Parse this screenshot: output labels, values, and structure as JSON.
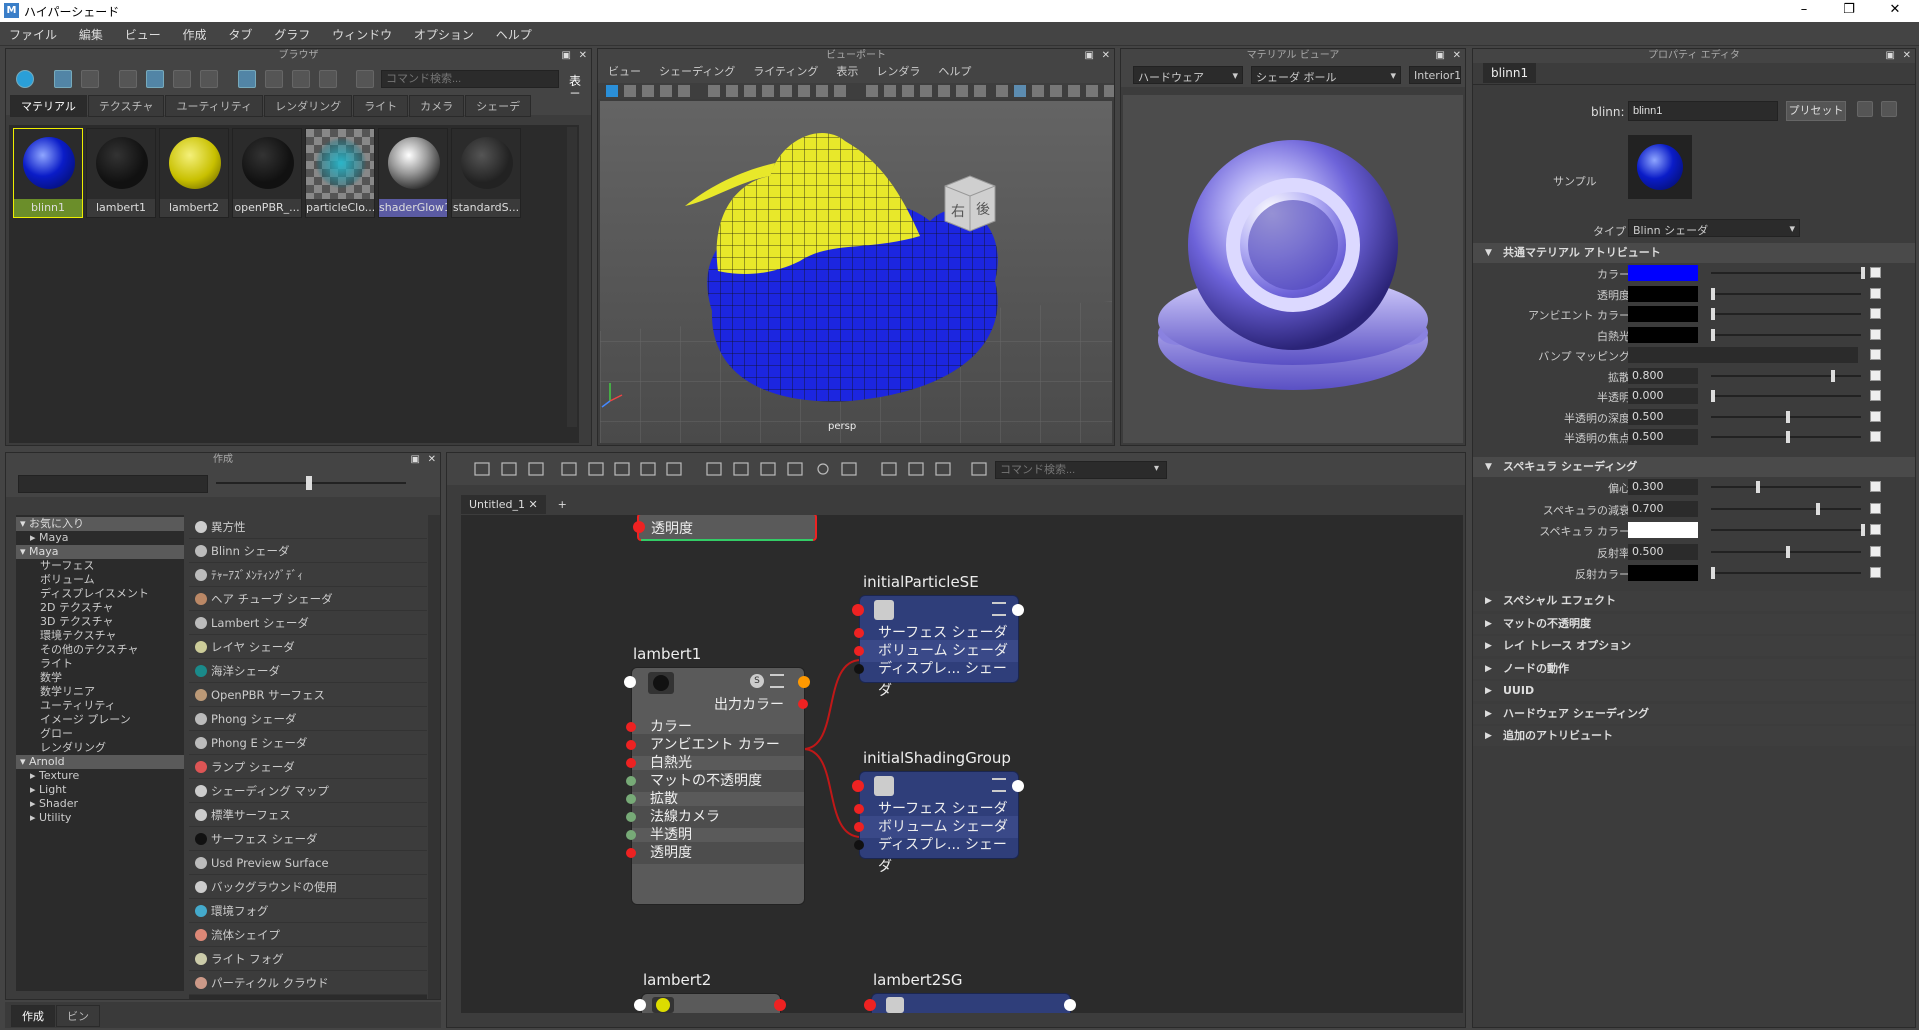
{
  "window": {
    "title": "ハイパーシェード",
    "min": "–",
    "max": "❐",
    "close": "✕"
  },
  "menu": [
    "ファイル",
    "編集",
    "ビュー",
    "作成",
    "タブ",
    "グラフ",
    "ウィンドウ",
    "オプション",
    "ヘルプ"
  ],
  "browser": {
    "title": "ブラウザ",
    "search_placeholder": "コマンド検索...",
    "show_label": "表示",
    "tabs": [
      "マテリアル",
      "テクスチャ",
      "ユーティリティ",
      "レンダリング",
      "ライト",
      "カメラ",
      "シェーデ"
    ],
    "swatches": [
      "blinn1",
      "lambert1",
      "lambert2",
      "openPBR_...",
      "particleClo...",
      "shaderGlow1",
      "standardS..."
    ]
  },
  "viewport": {
    "title": "ビューポート",
    "menu": [
      "ビュー",
      "シェーディング",
      "ライティング",
      "表示",
      "レンダラ",
      "ヘルプ"
    ],
    "camera": "persp",
    "cube_right": "右",
    "cube_back": "後"
  },
  "material_viewer": {
    "title": "マテリアル ビューア",
    "renderer": "ハードウェア",
    "shape": "シェーダ ボール",
    "env": "Interior1"
  },
  "property_editor": {
    "title": "プロパティ エディタ",
    "tab": "blinn1",
    "name_label": "blinn:",
    "name_value": "blinn1",
    "preset_button": "プリセット",
    "sample_label": "サンプル",
    "type_label": "タイプ",
    "type_value": "Blinn シェーダ",
    "section_common": "共通マテリアル アトリビュート",
    "common_rows": [
      {
        "label": "カラー",
        "value": "",
        "color": "#0000ff"
      },
      {
        "label": "透明度",
        "value": "",
        "color": "#000000"
      },
      {
        "label": "アンビエント カラー",
        "value": "",
        "color": "#000000"
      },
      {
        "label": "白熱光",
        "value": "",
        "color": "#000000"
      },
      {
        "label": "バンプ マッピング",
        "value": "",
        "color": ""
      },
      {
        "label": "拡散",
        "value": "0.800",
        "color": ""
      },
      {
        "label": "半透明",
        "value": "0.000",
        "color": ""
      },
      {
        "label": "半透明の深度",
        "value": "0.500",
        "color": ""
      },
      {
        "label": "半透明の焦点",
        "value": "0.500",
        "color": ""
      }
    ],
    "section_specular": "スペキュラ シェーディング",
    "spec_rows": [
      {
        "label": "偏心",
        "value": "0.300",
        "color": ""
      },
      {
        "label": "スペキュラの減衰",
        "value": "0.700",
        "color": ""
      },
      {
        "label": "スペキュラ カラー",
        "value": "",
        "color": "#ffffff"
      },
      {
        "label": "反射率",
        "value": "0.500",
        "color": ""
      },
      {
        "label": "反射カラー",
        "value": "",
        "color": "#000000"
      }
    ],
    "closed_sections": [
      "スペシャル エフェクト",
      "マットの不透明度",
      "レイ トレース オプション",
      "ノードの動作",
      "UUID",
      "ハードウェア シェーディング",
      "追加のアトリビュート"
    ]
  },
  "create_panel": {
    "title": "作成",
    "tree": [
      {
        "t": "お気に入り",
        "lvl": 0,
        "hdr": true
      },
      {
        "t": "Maya",
        "lvl": 1,
        "hdr": false
      },
      {
        "t": "Maya",
        "lvl": 0,
        "hdr": true
      },
      {
        "t": "サーフェス",
        "lvl": 2,
        "hdr": false
      },
      {
        "t": "ボリューム",
        "lvl": 2,
        "hdr": false
      },
      {
        "t": "ディスプレイスメント",
        "lvl": 2,
        "hdr": false
      },
      {
        "t": "2D テクスチャ",
        "lvl": 2,
        "hdr": false
      },
      {
        "t": "3D テクスチャ",
        "lvl": 2,
        "hdr": false
      },
      {
        "t": "環境テクスチャ",
        "lvl": 2,
        "hdr": false
      },
      {
        "t": "その他のテクスチャ",
        "lvl": 2,
        "hdr": false
      },
      {
        "t": "ライト",
        "lvl": 2,
        "hdr": false
      },
      {
        "t": "数学",
        "lvl": 2,
        "hdr": false
      },
      {
        "t": "数学リニア",
        "lvl": 2,
        "hdr": false
      },
      {
        "t": "ユーティリティ",
        "lvl": 2,
        "hdr": false
      },
      {
        "t": "イメージ プレーン",
        "lvl": 2,
        "hdr": false
      },
      {
        "t": "グロー",
        "lvl": 2,
        "hdr": false
      },
      {
        "t": "レンダリング",
        "lvl": 2,
        "hdr": false
      },
      {
        "t": "Arnold",
        "lvl": 0,
        "hdr": true
      },
      {
        "t": "Texture",
        "lvl": 1,
        "hdr": false
      },
      {
        "t": "Light",
        "lvl": 1,
        "hdr": false
      },
      {
        "t": "Shader",
        "lvl": 1,
        "hdr": false
      },
      {
        "t": "Utility",
        "lvl": 1,
        "hdr": false
      }
    ],
    "nodes": [
      "異方性",
      "Blinn シェーダ",
      "ﾃｬｰｱｽﾞﾒﾝﾃｨﾝｸﾞﾃﾞｨ",
      "ヘア チューブ シェーダ",
      "Lambert シェーダ",
      "レイヤ シェーダ",
      "海洋シェーダ",
      "OpenPBR サーフェス",
      "Phong シェーダ",
      "Phong E シェーダ",
      "ランプ シェーダ",
      "シェーディング マップ",
      "標準サーフェス",
      "サーフェス シェーダ",
      "Usd Preview Surface",
      "バックグラウンドの使用",
      "環境フォグ",
      "流体シェイプ",
      "ライト フォグ",
      "パーティクル クラウド"
    ],
    "bottom_tabs": [
      "作成",
      "ビン"
    ]
  },
  "node_editor": {
    "search_placeholder": "コマンド検索...",
    "tab": "Untitled_1",
    "top_stub": "透明度",
    "lambert1": {
      "title": "lambert1",
      "out": "出力カラー",
      "rows": [
        "カラー",
        "アンビエント カラー",
        "白熱光",
        "マットの不透明度",
        "拡散",
        "法線カメラ",
        "半透明",
        "透明度"
      ]
    },
    "initialParticleSE": {
      "title": "initialParticleSE",
      "rows": [
        "サーフェス シェーダ",
        "ボリューム シェーダ",
        "ディスプレ... シェーダ"
      ]
    },
    "initialShadingGroup": {
      "title": "initialShadingGroup",
      "rows": [
        "サーフェス シェーダ",
        "ボリューム シェーダ",
        "ディスプレ... シェーダ"
      ]
    },
    "lambert2": {
      "title": "lambert2"
    },
    "lambert2SG": {
      "title": "lambert2SG"
    }
  }
}
